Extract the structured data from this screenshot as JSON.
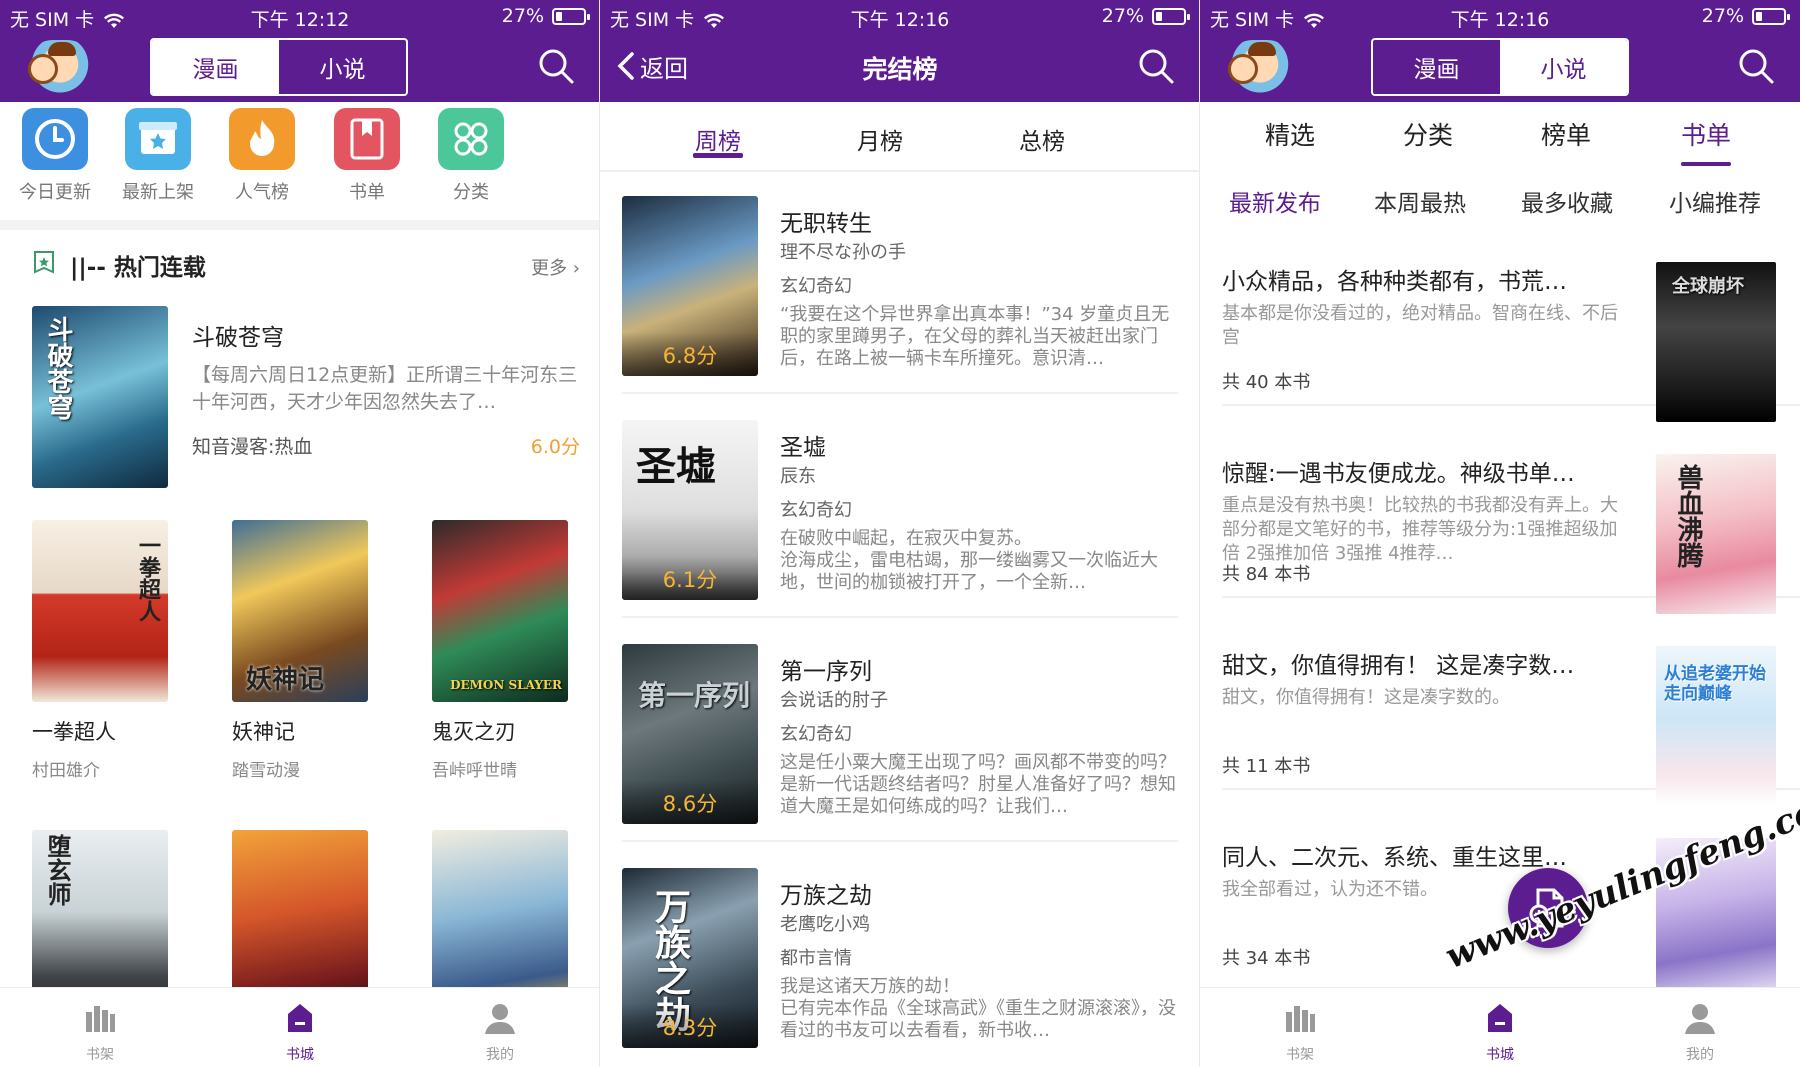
{
  "status": {
    "p1": {
      "carrier": "无 SIM 卡",
      "time": "下午 12:12",
      "battery": "27%"
    },
    "p2": {
      "carrier": "无 SIM 卡",
      "time": "下午 12:16",
      "battery": "27%"
    },
    "p3": {
      "carrier": "无 SIM 卡",
      "time": "下午 12:16",
      "battery": "27%"
    }
  },
  "colors": {
    "brand": "#5c1d91",
    "score": "#f0a030"
  },
  "p1": {
    "seg": {
      "comic": "漫画",
      "novel": "小说"
    },
    "quicknav": [
      {
        "label": "今日更新",
        "icon": "clock-icon",
        "color": "#3d8fe0"
      },
      {
        "label": "最新上架",
        "icon": "star-box-icon",
        "color": "#4ab0e8"
      },
      {
        "label": "人气榜",
        "icon": "flame-icon",
        "color": "#f39a2c"
      },
      {
        "label": "书单",
        "icon": "bookmark-book-icon",
        "color": "#e45562"
      },
      {
        "label": "分类",
        "icon": "category-grid-icon",
        "color": "#4cc79a"
      }
    ],
    "section": {
      "title": "||-- 热门连载",
      "more": "更多"
    },
    "featured": {
      "title": "斗破苍穹",
      "desc": "【每周六周日12点更新】正所谓三十年河东三十年河西，天才少年因忽然失去了…",
      "tag": "知音漫客:热血",
      "score": "6.0分"
    },
    "grid": [
      {
        "name": "一拳超人",
        "author": "村田雄介",
        "cover_text": "一拳超人"
      },
      {
        "name": "妖神记",
        "author": "踏雪动漫",
        "cover_text": "妖神记"
      },
      {
        "name": "鬼灭之刃",
        "author": "吾峠呼世晴",
        "cover_text": "DEMON SLAYER"
      },
      {
        "name": "",
        "author": "",
        "cover_text": "堕玄师"
      },
      {
        "name": "",
        "author": "",
        "cover_text": ""
      },
      {
        "name": "",
        "author": "",
        "cover_text": ""
      }
    ]
  },
  "p2": {
    "back": "返回",
    "title": "完结榜",
    "tabs": [
      "周榜",
      "月榜",
      "总榜"
    ],
    "items": [
      {
        "title": "无职转生",
        "author": "理不尽な孙の手",
        "genre": "玄幻奇幻",
        "score": "6.8分",
        "desc": "“我要在这个异世界拿出真本事！”34 岁童贞且无职的家里蹲男子，在父母的葬礼当天被赶出家门后，在路上被一辆卡车所撞死。意识清…"
      },
      {
        "title": "圣墟",
        "author": "辰东",
        "genre": "玄幻奇幻",
        "score": "6.1分",
        "desc": "在破败中崛起，在寂灭中复苏。\n      沧海成尘，雷电枯竭，那一缕幽雾又一次临近大地，世间的枷锁被打开了，一个全新…",
        "cover_text": "圣墟"
      },
      {
        "title": "第一序列",
        "author": "会说话的肘子",
        "genre": "玄幻奇幻",
        "score": "8.6分",
        "desc": "这是任小粟大魔王出现了吗？画风都不带变的吗？是新一代话题终结者吗？肘星人准备好了吗？想知道大魔王是如何练成的吗？让我们…",
        "cover_text": "第一序列"
      },
      {
        "title": "万族之劫",
        "author": "老鹰吃小鸡",
        "genre": "都市言情",
        "score": "8.3分",
        "desc": "我是这诸天万族的劫！\n      已有完本作品《全球高武》《重生之财源滚滚》，没看过的书友可以去看看，新书收…",
        "cover_text": "万族之劫"
      }
    ]
  },
  "p3": {
    "seg": {
      "comic": "漫画",
      "novel": "小说"
    },
    "tabs": [
      "精选",
      "分类",
      "榜单",
      "书单"
    ],
    "sub": [
      "最新发布",
      "本周最热",
      "最多收藏",
      "小编推荐"
    ],
    "items": [
      {
        "title": "小众精品，各种种类都有，书荒…",
        "desc": "基本都是你没看过的，绝对精品。智商在线、不后宫",
        "count": "共 40 本书",
        "cover_text": "全球崩坏"
      },
      {
        "title": "惊醒:一遇书友便成龙。神级书单…",
        "desc": "重点是没有热书奥！比较热的书我都没有弄上。大部分都是文笔好的书，推荐等级分为:1强推超级加倍 2强推加倍 3强推 4推荐…",
        "count": "共 84 本书",
        "cover_text": "兽血沸腾"
      },
      {
        "title": "甜文，你值得拥有！ 这是凑字数…",
        "desc": "甜文，你值得拥有！这是凑字数的。",
        "count": "共 11 本书",
        "cover_text": "从追老婆开始走向巅峰"
      },
      {
        "title": "同人、二次元、系统、重生这里…",
        "desc": "我全部看过，认为还不错。",
        "count": "共 34 本书",
        "cover_text": ""
      }
    ]
  },
  "tabbar": [
    {
      "label": "书架",
      "icon": "bookshelf-icon"
    },
    {
      "label": "书城",
      "icon": "bookstore-icon"
    },
    {
      "label": "我的",
      "icon": "profile-icon"
    }
  ],
  "watermark": "www.yeyulingfeng.com"
}
